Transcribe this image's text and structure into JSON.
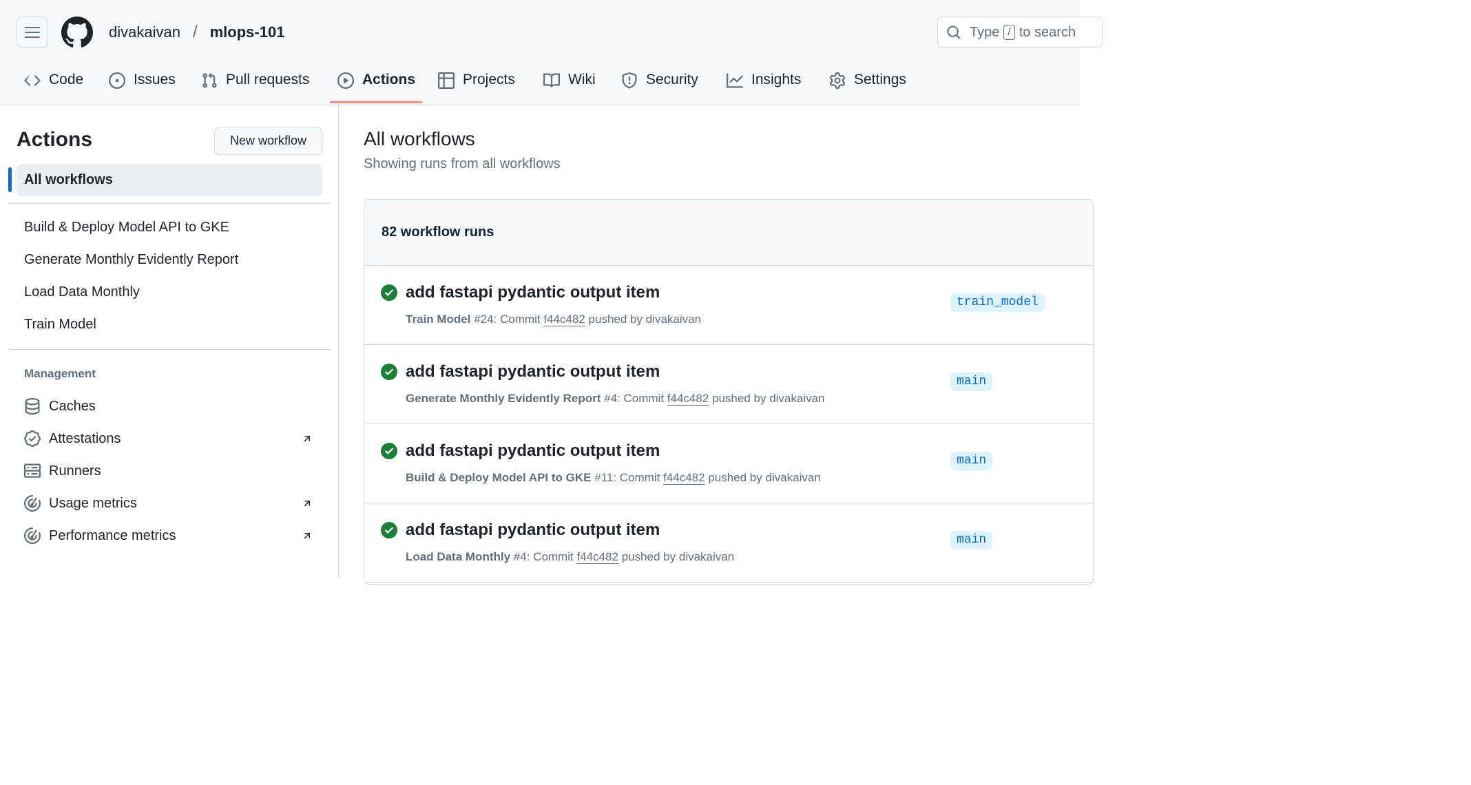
{
  "header": {
    "owner": "divakaivan",
    "separator": "/",
    "repo": "mlops-101",
    "search": {
      "prefix": "Type",
      "key": "/",
      "suffix": "to search"
    }
  },
  "tabs": [
    {
      "label": "Code",
      "icon": "code-icon"
    },
    {
      "label": "Issues",
      "icon": "issue-opened-icon"
    },
    {
      "label": "Pull requests",
      "icon": "git-pull-request-icon"
    },
    {
      "label": "Actions",
      "icon": "play-icon",
      "active": true
    },
    {
      "label": "Projects",
      "icon": "table-icon"
    },
    {
      "label": "Wiki",
      "icon": "book-icon"
    },
    {
      "label": "Security",
      "icon": "shield-icon"
    },
    {
      "label": "Insights",
      "icon": "graph-icon"
    },
    {
      "label": "Settings",
      "icon": "gear-icon"
    }
  ],
  "sidebar": {
    "title": "Actions",
    "new_workflow": "New workflow",
    "all_workflows": "All workflows",
    "workflows": [
      "Build & Deploy Model API to GKE",
      "Generate Monthly Evidently Report",
      "Load Data Monthly",
      "Train Model"
    ],
    "management_heading": "Management",
    "management": [
      {
        "label": "Caches",
        "icon": "database-icon",
        "external": false
      },
      {
        "label": "Attestations",
        "icon": "verified-icon",
        "external": true
      },
      {
        "label": "Runners",
        "icon": "server-icon",
        "external": false
      },
      {
        "label": "Usage metrics",
        "icon": "meter-icon",
        "external": true
      },
      {
        "label": "Performance metrics",
        "icon": "meter-icon",
        "external": true
      }
    ]
  },
  "main": {
    "title": "All workflows",
    "subtitle": "Showing runs from all workflows",
    "runs_count": "82 workflow runs",
    "runs": [
      {
        "title": "add fastapi pydantic output item",
        "workflow": "Train Model",
        "number": "#24",
        "commit_label": ": Commit",
        "sha": "f44c482",
        "pushed_by": "pushed by divakaivan",
        "branch": "train_model",
        "status": "success"
      },
      {
        "title": "add fastapi pydantic output item",
        "workflow": "Generate Monthly Evidently Report",
        "number": "#4",
        "commit_label": ": Commit",
        "sha": "f44c482",
        "pushed_by": "pushed by divakaivan",
        "branch": "main",
        "status": "success"
      },
      {
        "title": "add fastapi pydantic output item",
        "workflow": "Build & Deploy Model API to GKE",
        "number": "#11",
        "commit_label": ": Commit",
        "sha": "f44c482",
        "pushed_by": "pushed by divakaivan",
        "branch": "main",
        "status": "success"
      },
      {
        "title": "add fastapi pydantic output item",
        "workflow": "Load Data Monthly",
        "number": "#4",
        "commit_label": ": Commit",
        "sha": "f44c482",
        "pushed_by": "pushed by divakaivan",
        "branch": "main",
        "status": "success"
      }
    ]
  },
  "colors": {
    "accent": "#0969da",
    "success": "#1a7f37",
    "tab_underline": "#fd8c73",
    "branch_bg": "#ddf4ff"
  }
}
